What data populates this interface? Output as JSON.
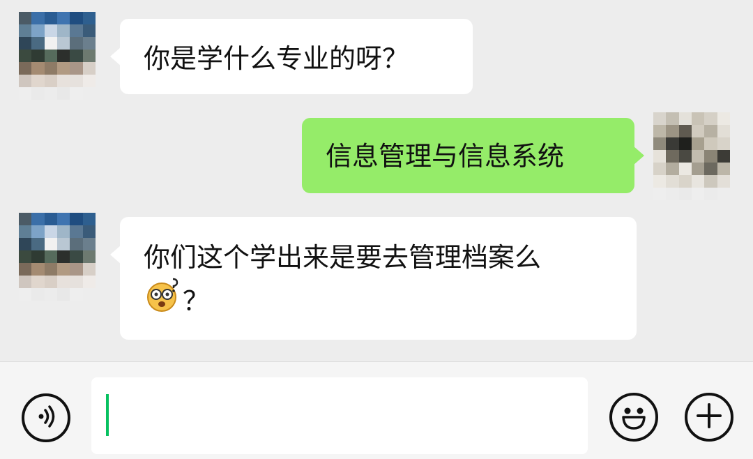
{
  "messages": [
    {
      "side": "left",
      "text": "你是学什么专业的呀？"
    },
    {
      "side": "right",
      "text": "信息管理与信息系统"
    },
    {
      "side": "left",
      "text": "你们这个学出来是要去管理档案么",
      "emoji": "dizzy-face-emoji",
      "text_after_emoji": "？"
    }
  ],
  "input_bar": {
    "text_value": "",
    "voice_icon": "voice-icon",
    "emoji_icon": "smiley-icon",
    "more_icon": "plus-icon",
    "caret_color": "#07c160"
  },
  "colors": {
    "background": "#ededed",
    "incoming_bubble": "#ffffff",
    "outgoing_bubble": "#95ec69",
    "input_bar": "#f5f5f5"
  }
}
